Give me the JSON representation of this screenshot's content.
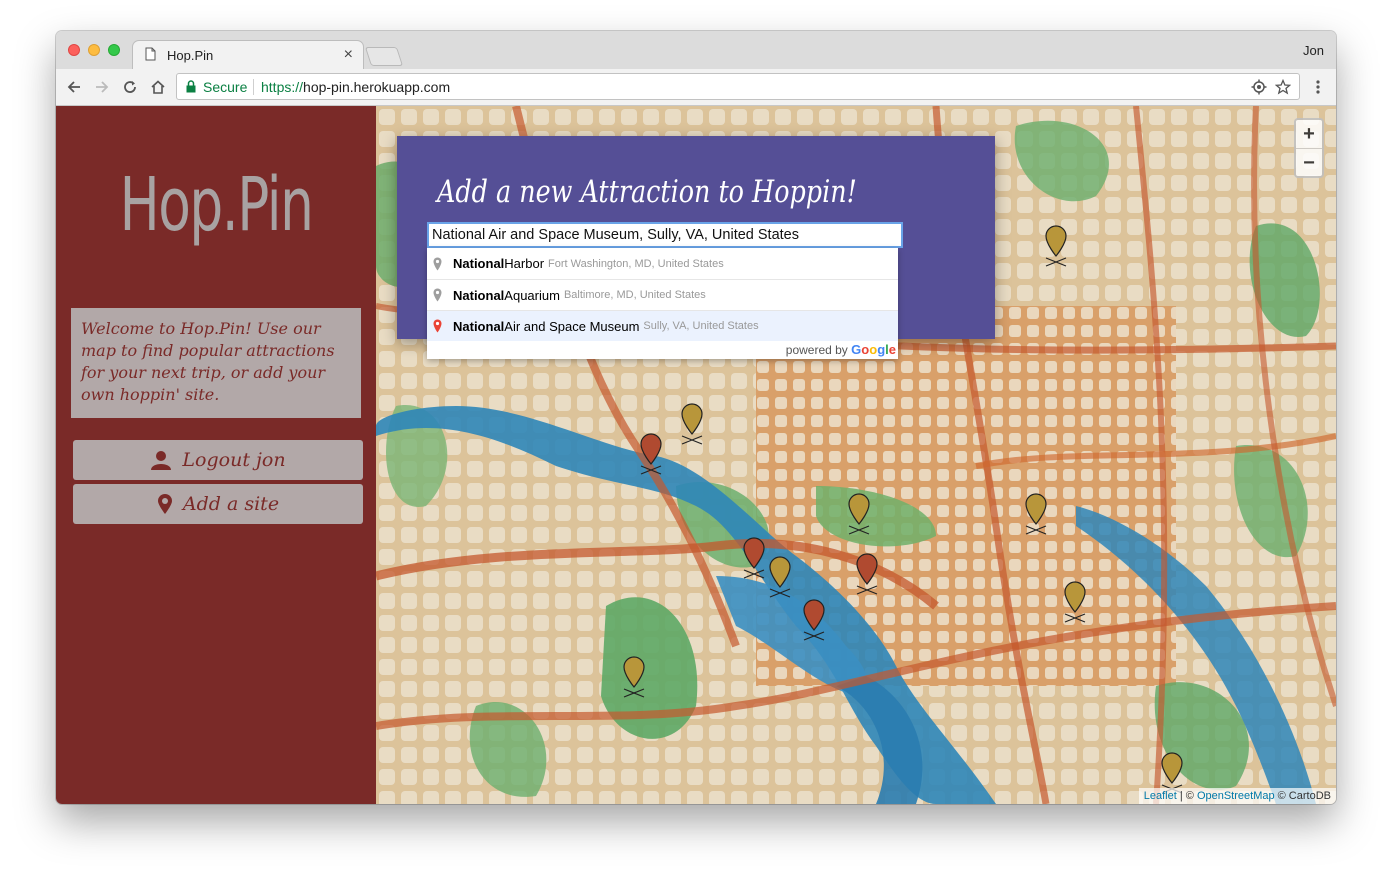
{
  "browser": {
    "tab_title": "Hop.Pin",
    "tab_close": "×",
    "user_name": "Jon",
    "secure_label": "Secure",
    "url_scheme": "https://",
    "url_host": "hop-pin.herokuapp.com"
  },
  "sidebar": {
    "logo": "Hop.Pin",
    "welcome_text": "Welcome to Hop.Pin! Use our map to find popular attractions for your next trip, or add your own hoppin' site.",
    "logout_label": "Logout jon",
    "add_site_label": "Add a site"
  },
  "panel": {
    "title": "Add a new Attraction to Hoppin!",
    "search_value": "National Air and Space Museum, Sully, VA, United States"
  },
  "autocomplete": {
    "items": [
      {
        "matched": "National",
        "rest": " Harbor",
        "secondary": "Fort Washington, MD, United States",
        "selected": false
      },
      {
        "matched": "National",
        "rest": " Aquarium",
        "secondary": "Baltimore, MD, United States",
        "selected": false
      },
      {
        "matched": "National",
        "rest": " Air and Space Museum",
        "secondary": "Sully, VA, United States",
        "selected": true
      }
    ],
    "powered_by": "powered by",
    "google": "Google"
  },
  "map": {
    "zoom_in": "+",
    "zoom_out": "−",
    "attribution_leaflet": "Leaflet",
    "attribution_sep": " | © ",
    "attribution_osm": "OpenStreetMap",
    "attribution_carto": " © CartoDB",
    "marker_colors": {
      "gold": "#b8963a",
      "red": "#b04a30"
    }
  },
  "colors": {
    "sidebar_bg": "#7a2a28",
    "panel_bg": "#554f96",
    "button_bg": "#b2a8a8"
  }
}
